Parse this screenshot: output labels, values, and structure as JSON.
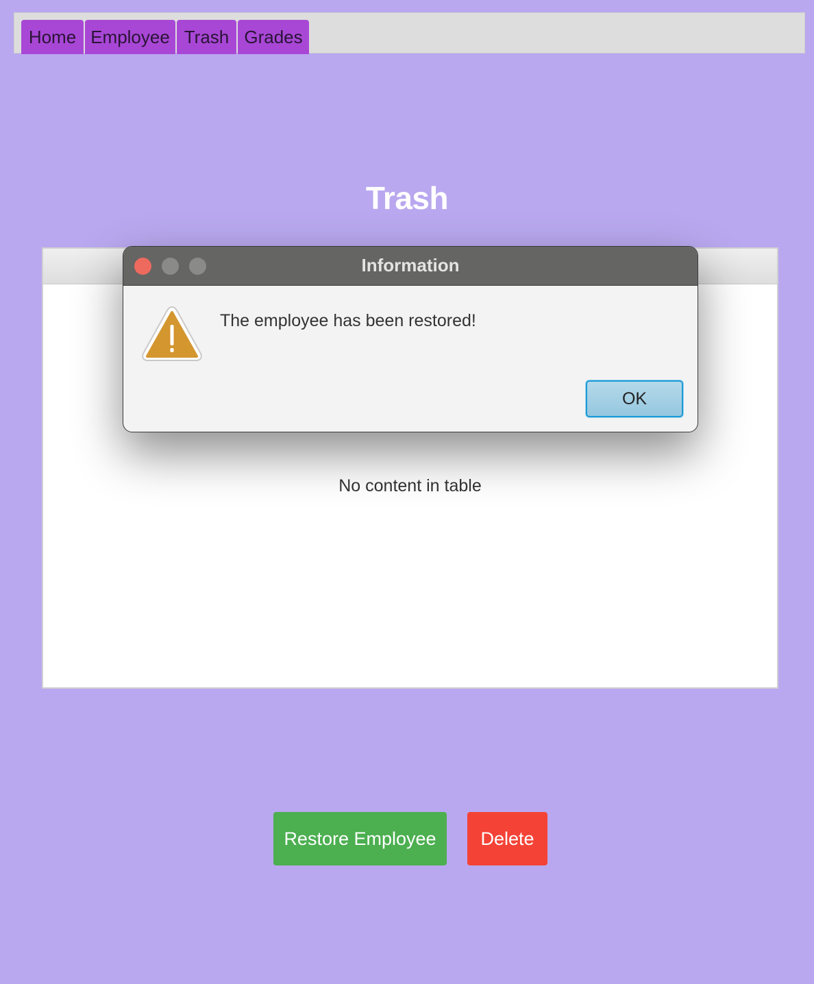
{
  "menu": {
    "tabs": [
      {
        "label": "Home"
      },
      {
        "label": "Employee"
      },
      {
        "label": "Trash"
      },
      {
        "label": "Grades"
      }
    ]
  },
  "main": {
    "title": "Trash",
    "table": {
      "columns": [],
      "rows": [],
      "placeholder": "No content in table"
    },
    "actions": {
      "restore_label": "Restore Employee",
      "delete_label": "Delete"
    }
  },
  "dialog": {
    "title": "Information",
    "message": "The employee has been restored!",
    "ok_label": "OK",
    "icon": "warning-icon"
  },
  "colors": {
    "background": "#b9a8ef",
    "tab": "#a847d6",
    "restore_button": "#4caf50",
    "delete_button": "#f44336",
    "dialog_titlebar": "#656563",
    "warning": "#d4962f"
  }
}
